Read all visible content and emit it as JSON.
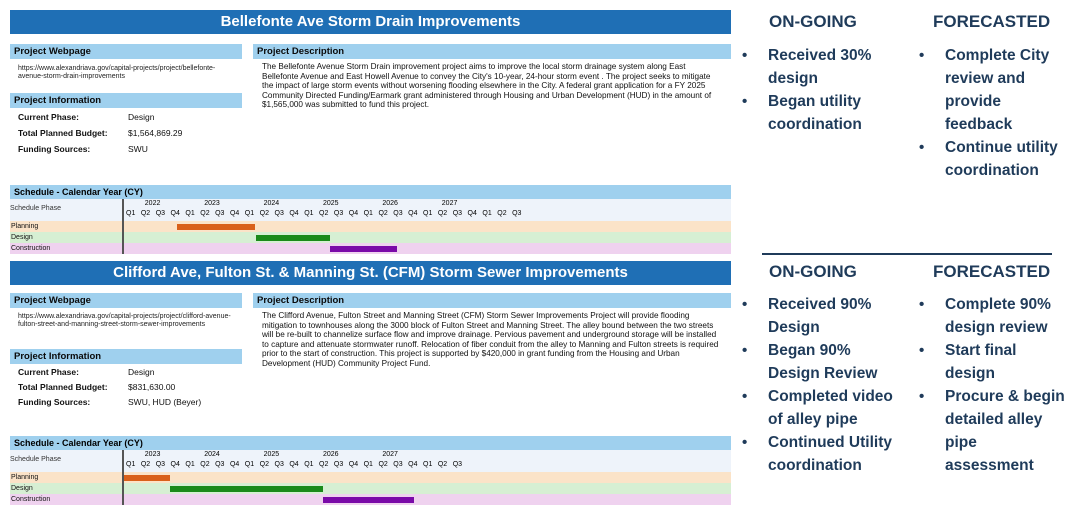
{
  "projects": [
    {
      "title": "Bellefonte Ave Storm Drain Improvements",
      "webpage_label": "Project Webpage",
      "webpage_url": "https://www.alexandriava.gov/capital-projects/project/bellefonte-avenue-storm-drain-improvements",
      "info_label": "Project Information",
      "info": [
        {
          "k": "Current Phase:",
          "v": "Design"
        },
        {
          "k": "Total Planned Budget:",
          "v": "$1,564,869.29"
        },
        {
          "k": "Funding Sources:",
          "v": "SWU"
        }
      ],
      "desc_label": "Project Description",
      "description": "The Bellefonte Avenue Storm Drain improvement project aims to improve the local storm drainage system along East Bellefonte Avenue and East Howell Avenue to convey the City's 10-year, 24-hour storm event . The project seeks to mitigate the impact of large storm events without worsening flooding elsewhere in the City. A federal grant application for a FY 2025 Community Directed Funding/Earmark grant administered through Housing and Urban Development (HUD) in the amount of $1,565,000 was submitted to fund this project.",
      "schedule_label": "Schedule - Calendar Year (CY)",
      "schedule_phase_label": "Schedule Phase",
      "years": [
        "2022",
        "2023",
        "2024",
        "2025",
        "2026",
        "2027"
      ],
      "quarters": [
        "Q1",
        "Q2",
        "Q3",
        "Q4",
        "Q1",
        "Q2",
        "Q3",
        "Q4",
        "Q1",
        "Q2",
        "Q3",
        "Q4",
        "Q1",
        "Q2",
        "Q3",
        "Q4",
        "Q1",
        "Q2",
        "Q3",
        "Q4",
        "Q1",
        "Q2",
        "Q3",
        "Q4",
        "Q1",
        "Q2",
        "Q3"
      ],
      "phases": [
        "Planning",
        "Design",
        "Construction"
      ],
      "bars": [
        {
          "phase": "Planning",
          "start_q": 3.6,
          "end_q": 8.8,
          "color": "#d9601a"
        },
        {
          "phase": "Design",
          "start_q": 8.9,
          "end_q": 13.9,
          "color": "#1a8a1a"
        },
        {
          "phase": "Construction",
          "start_q": 13.9,
          "end_q": 18.4,
          "color": "#7a0aa8"
        }
      ],
      "current_q": 13.2
    },
    {
      "title": "Clifford Ave, Fulton St. & Manning St. (CFM) Storm Sewer Improvements",
      "webpage_label": "Project Webpage",
      "webpage_url": "https://www.alexandriava.gov/capital-projects/project/clifford-avenue-fulton-street-and-manning-street-storm-sewer-improvements",
      "info_label": "Project Information",
      "info": [
        {
          "k": "Current Phase:",
          "v": "Design"
        },
        {
          "k": "Total Planned Budget:",
          "v": "$831,630.00"
        },
        {
          "k": "Funding Sources:",
          "v": "SWU, HUD (Beyer)"
        }
      ],
      "desc_label": "Project Description",
      "description": "The Clifford Avenue, Fulton Street and Manning Street (CFM) Storm Sewer Improvements Project will provide flooding mitigation to townhouses along the 3000 block of Fulton Street and Manning Street. The alley bound between the two streets will be re-built to channelize surface flow and improve drainage. Pervious pavement and underground storage will be installed to capture and attenuate stormwater runoff. Relocation of fiber conduit from the alley to Manning and Fulton streets is required prior to the start of construction. This project is supported by $420,000 in grant funding from the Housing and Urban Development (HUD) Community Project Fund.",
      "schedule_label": "Schedule - Calendar Year (CY)",
      "schedule_phase_label": "Schedule Phase",
      "years": [
        "2023",
        "2024",
        "2025",
        "2026",
        "2027"
      ],
      "quarters": [
        "Q1",
        "Q2",
        "Q3",
        "Q4",
        "Q1",
        "Q2",
        "Q3",
        "Q4",
        "Q1",
        "Q2",
        "Q3",
        "Q4",
        "Q1",
        "Q2",
        "Q3",
        "Q4",
        "Q1",
        "Q2",
        "Q3",
        "Q4",
        "Q1",
        "Q2",
        "Q3"
      ],
      "phases": [
        "Planning",
        "Design",
        "Construction"
      ],
      "bars": [
        {
          "phase": "Planning",
          "start_q": 0.0,
          "end_q": 3.1,
          "color": "#d9601a"
        },
        {
          "phase": "Design",
          "start_q": 3.1,
          "end_q": 13.4,
          "color": "#1a8a1a"
        },
        {
          "phase": "Construction",
          "start_q": 13.4,
          "end_q": 19.5,
          "color": "#7a0aa8"
        }
      ],
      "current_q": 12.9
    }
  ],
  "status": [
    {
      "ongoing_heading": "ON-GOING",
      "forecasted_heading": "FORECASTED",
      "ongoing": [
        "Received 30% design",
        "Began utility coordination"
      ],
      "forecasted": [
        "Complete City review and provide feedback",
        "Continue utility coordination"
      ]
    },
    {
      "ongoing_heading": "ON-GOING",
      "forecasted_heading": "FORECASTED",
      "ongoing": [
        "Received 90% Design",
        "Began 90% Design Review",
        "Completed video of alley pipe",
        "Continued Utility coordination"
      ],
      "forecasted": [
        "Complete 90% design review",
        "Start final design",
        "Procure & begin detailed alley pipe assessment"
      ]
    }
  ],
  "colors": {
    "banner": "#1f6fb5",
    "label": "#9fd0ee",
    "lane_planning": "#fbe3c8",
    "lane_design": "#d6efd3",
    "lane_construction": "#efd2ef",
    "text_dark": "#1f3b5a"
  }
}
